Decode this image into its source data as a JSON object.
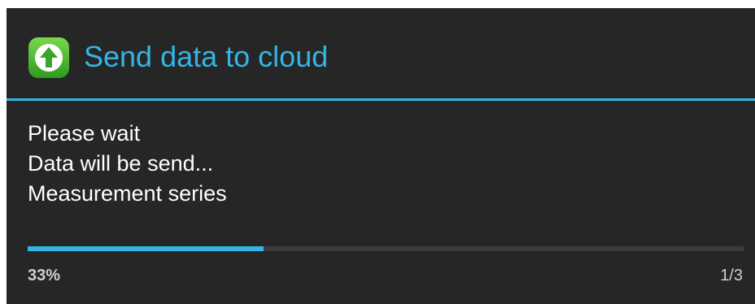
{
  "dialog": {
    "title": "Send data to cloud",
    "icon": "upload-arrow-icon",
    "message_lines": [
      "Please wait",
      "Data will be send...",
      "Measurement series"
    ],
    "progress": {
      "fraction": 0.33,
      "percent_label": "33%",
      "count_label": "1/3"
    }
  },
  "colors": {
    "accent": "#33b5e5",
    "background": "#262626",
    "icon_green": "#43b02a"
  }
}
